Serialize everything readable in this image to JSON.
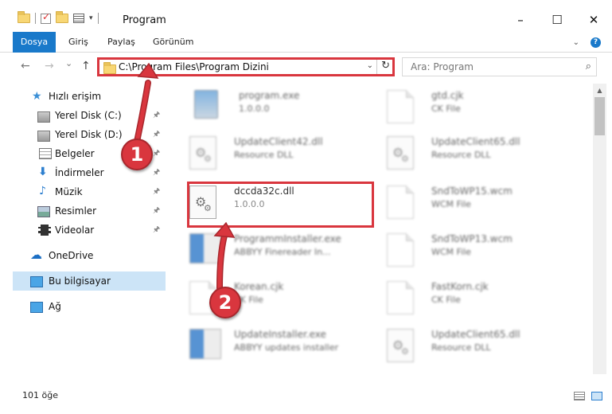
{
  "window": {
    "title": "Program",
    "controls": {
      "minimize": "–",
      "maximize": "☐",
      "close": "✕"
    }
  },
  "ribbon": {
    "tabs": [
      {
        "label": "Dosya",
        "active": true
      },
      {
        "label": "Giriş"
      },
      {
        "label": "Paylaş"
      },
      {
        "label": "Görünüm"
      }
    ],
    "expand_icon": "chevron-down-icon",
    "help_icon": "help-icon",
    "help_glyph": "?"
  },
  "nav": {
    "back": "←",
    "forward": "→",
    "recent": "⌄",
    "up": "↑",
    "address": "C:\\Program Files\\Program Dizini",
    "address_dropdown": "⌄",
    "refresh": "↻",
    "search_placeholder": "Ara: Program",
    "search_glyph": "⌕"
  },
  "sidebar": {
    "items": [
      {
        "label": "Hızlı erişim",
        "icon": "star-icon"
      },
      {
        "label": "Yerel Disk (C:)",
        "icon": "drive-icon",
        "pinned": true
      },
      {
        "label": "Yerel Disk (D:)",
        "icon": "drive-icon",
        "pinned": true
      },
      {
        "label": "Belgeler",
        "icon": "documents-icon",
        "pinned": true
      },
      {
        "label": "İndirmeler",
        "icon": "download-icon",
        "pinned": true
      },
      {
        "label": "Müzik",
        "icon": "music-icon",
        "pinned": true
      },
      {
        "label": "Resimler",
        "icon": "pictures-icon",
        "pinned": true
      },
      {
        "label": "Videolar",
        "icon": "videos-icon",
        "pinned": true
      },
      {
        "label": "OneDrive",
        "icon": "onedrive-icon"
      },
      {
        "label": "Bu bilgisayar",
        "icon": "this-pc-icon",
        "selected": true
      },
      {
        "label": "Ağ",
        "icon": "network-icon"
      }
    ],
    "pin_glyph": "📌"
  },
  "files": [
    {
      "name": "program.exe",
      "sub": "1.0.0.0",
      "icon": "exe-icon",
      "blurred": true
    },
    {
      "name": "gtd.cjk",
      "sub": "CK File",
      "icon": "file-icon",
      "blurred": true
    },
    {
      "name": "UpdateClient42.dll",
      "sub": "Resource DLL",
      "icon": "dll-gear-icon",
      "blurred": true
    },
    {
      "name": "UpdateClient65.dll",
      "sub": "Resource DLL",
      "icon": "dll-gear-icon",
      "blurred": true
    },
    {
      "name": "dccda32c.dll",
      "sub": "1.0.0.0",
      "icon": "dll-gear-icon",
      "blurred": false
    },
    {
      "name": "SndToWP15.wcm",
      "sub": "WCM File",
      "icon": "file-icon",
      "blurred": true
    },
    {
      "name": "ProgrammInstaller.exe",
      "sub": "ABBYY Finereader In...",
      "icon": "setup-icon",
      "blurred": true
    },
    {
      "name": "SndToWP13.wcm",
      "sub": "WCM File",
      "icon": "file-icon",
      "blurred": true
    },
    {
      "name": "Korean.cjk",
      "sub": "CK File",
      "icon": "file-icon",
      "blurred": true
    },
    {
      "name": "FastKorn.cjk",
      "sub": "CK File",
      "icon": "file-icon",
      "blurred": true
    },
    {
      "name": "UpdateInstaller.exe",
      "sub": "ABBYY updates installer",
      "icon": "setup-icon",
      "blurred": true
    },
    {
      "name": "UpdateClient65.dll",
      "sub": "Resource DLL",
      "icon": "dll-gear-icon",
      "blurred": true
    }
  ],
  "status": {
    "count": "101 öğe"
  },
  "annotations": {
    "callout_1": "1",
    "callout_2": "2",
    "accent_color": "#d9363e"
  },
  "colors": {
    "file_tab": "#1979ca",
    "selection": "#cce4f7"
  }
}
